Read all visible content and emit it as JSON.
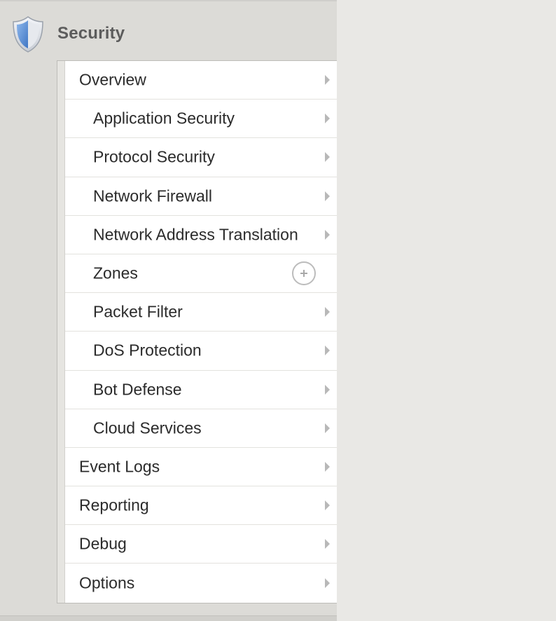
{
  "header": {
    "title": "Security",
    "icon": "shield-icon"
  },
  "menu": {
    "items": [
      {
        "label": "Overview",
        "level": 0,
        "action": "arrow"
      },
      {
        "label": "Application Security",
        "level": 1,
        "action": "arrow"
      },
      {
        "label": "Protocol Security",
        "level": 1,
        "action": "arrow"
      },
      {
        "label": "Network Firewall",
        "level": 1,
        "action": "arrow"
      },
      {
        "label": "Network Address Translation",
        "level": 1,
        "action": "arrow"
      },
      {
        "label": "Zones",
        "level": 1,
        "action": "add"
      },
      {
        "label": "Packet Filter",
        "level": 1,
        "action": "arrow"
      },
      {
        "label": "DoS Protection",
        "level": 1,
        "action": "arrow"
      },
      {
        "label": "Bot Defense",
        "level": 1,
        "action": "arrow"
      },
      {
        "label": "Cloud Services",
        "level": 1,
        "action": "arrow"
      },
      {
        "label": "Event Logs",
        "level": 0,
        "action": "arrow"
      },
      {
        "label": "Reporting",
        "level": 0,
        "action": "arrow"
      },
      {
        "label": "Debug",
        "level": 0,
        "action": "arrow"
      },
      {
        "label": "Options",
        "level": 0,
        "action": "arrow"
      }
    ]
  },
  "colors": {
    "panel_bg": "#dcdbd7",
    "page_bg": "#e9e8e5",
    "menu_bg": "#ffffff",
    "text": "#2b2b2b",
    "header_text": "#5c5c5c",
    "shield_blue": "#5b8fd4"
  }
}
